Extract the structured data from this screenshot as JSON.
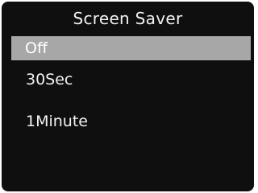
{
  "title": "Screen Saver",
  "menu": {
    "items": [
      {
        "label": "Off",
        "selected": true
      },
      {
        "label": "30Sec",
        "selected": false
      },
      {
        "label": "1Minute",
        "selected": false
      }
    ]
  },
  "colors": {
    "background": "#0f0f0f",
    "text": "#f2f2f2",
    "selection": "#a7a7a7"
  }
}
